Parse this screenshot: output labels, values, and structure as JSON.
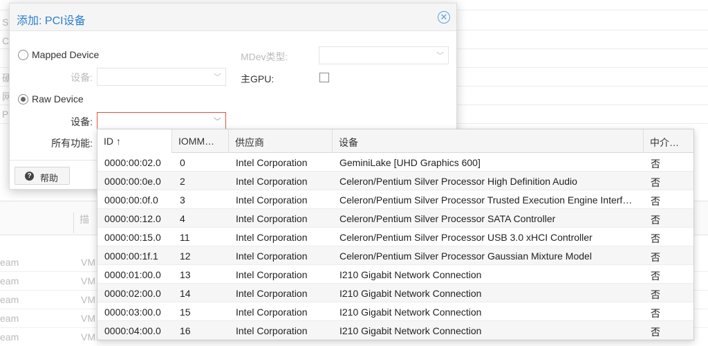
{
  "background": {
    "side_letters": [
      "S",
      "C",
      "硬",
      "网",
      "P"
    ],
    "lower_header_label": "描",
    "lower_rows": [
      {
        "left": "eam",
        "right": "VM"
      },
      {
        "left": "eam",
        "right": "VM"
      },
      {
        "left": "eam",
        "right": "VM"
      },
      {
        "left": "eam",
        "right": "VM"
      },
      {
        "left": "eam",
        "right": "VM"
      }
    ]
  },
  "dialog": {
    "title": "添加: PCI设备",
    "mapped_device_label": "Mapped Device",
    "mapped_device_field_label": "设备:",
    "mdev_type_label": "MDev类型:",
    "primary_gpu_label": "主GPU:",
    "raw_device_label": "Raw Device",
    "raw_device_field_label": "设备:",
    "all_functions_label": "所有功能:",
    "help_label": "帮助"
  },
  "grid": {
    "columns": [
      "ID ↑",
      "IOMM…",
      "供应商",
      "设备",
      "中介…"
    ],
    "rows": [
      {
        "id": "0000:00:02.0",
        "iommu": "0",
        "vendor": "Intel Corporation",
        "device": "GeminiLake [UHD Graphics 600]",
        "mdev": "否"
      },
      {
        "id": "0000:00:0e.0",
        "iommu": "2",
        "vendor": "Intel Corporation",
        "device": "Celeron/Pentium Silver Processor High Definition Audio",
        "mdev": "否"
      },
      {
        "id": "0000:00:0f.0",
        "iommu": "3",
        "vendor": "Intel Corporation",
        "device": "Celeron/Pentium Silver Processor Trusted Execution Engine Interf…",
        "mdev": "否"
      },
      {
        "id": "0000:00:12.0",
        "iommu": "4",
        "vendor": "Intel Corporation",
        "device": "Celeron/Pentium Silver Processor SATA Controller",
        "mdev": "否"
      },
      {
        "id": "0000:00:15.0",
        "iommu": "11",
        "vendor": "Intel Corporation",
        "device": "Celeron/Pentium Silver Processor USB 3.0 xHCI Controller",
        "mdev": "否"
      },
      {
        "id": "0000:00:1f.1",
        "iommu": "12",
        "vendor": "Intel Corporation",
        "device": "Celeron/Pentium Silver Processor Gaussian Mixture Model",
        "mdev": "否"
      },
      {
        "id": "0000:01:00.0",
        "iommu": "13",
        "vendor": "Intel Corporation",
        "device": "I210 Gigabit Network Connection",
        "mdev": "否"
      },
      {
        "id": "0000:02:00.0",
        "iommu": "14",
        "vendor": "Intel Corporation",
        "device": "I210 Gigabit Network Connection",
        "mdev": "否"
      },
      {
        "id": "0000:03:00.0",
        "iommu": "15",
        "vendor": "Intel Corporation",
        "device": "I210 Gigabit Network Connection",
        "mdev": "否"
      },
      {
        "id": "0000:04:00.0",
        "iommu": "16",
        "vendor": "Intel Corporation",
        "device": "I210 Gigabit Network Connection",
        "mdev": "否"
      }
    ]
  },
  "icons": {
    "close": "close-circle-icon",
    "chevron": "chevron-down-icon",
    "help": "question-circle-icon"
  },
  "colors": {
    "title_blue": "#2a7fd1",
    "error_border": "#e0533b"
  }
}
